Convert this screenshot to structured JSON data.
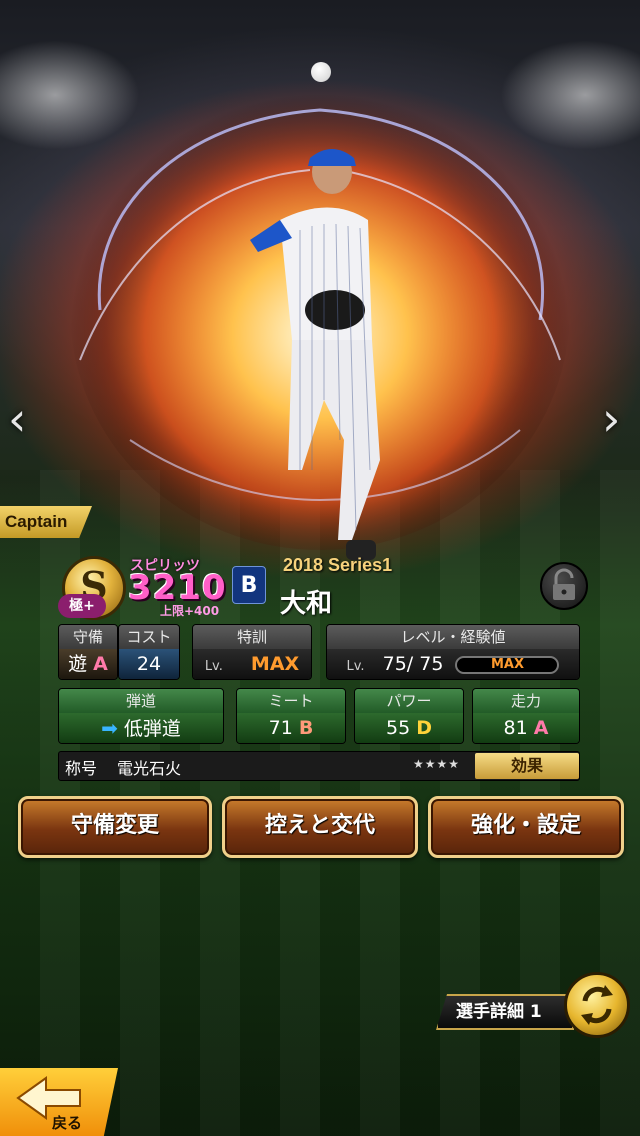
{
  "nav": {
    "prev_glyph": "‹",
    "next_glyph": "›"
  },
  "captain": {
    "label": "Captain"
  },
  "card": {
    "rarity": "S",
    "kiwami_label": "極+",
    "spirits_label": "スピリッツ",
    "spirits_value": "3210",
    "spirits_cap_label": "上限+400",
    "team_logo": "B",
    "series": "2018 Series1",
    "name": "大和"
  },
  "stats": {
    "position": {
      "header": "守備",
      "value": "遊",
      "grade": "A"
    },
    "cost": {
      "header": "コスト",
      "value": "24"
    },
    "training": {
      "header": "特訓",
      "lv_label": "Lv.",
      "value": "MAX"
    },
    "level": {
      "header": "レベル・経験値",
      "lv_label": "Lv.",
      "current": "75",
      "sep": "/",
      "max": "75",
      "exp_label": "MAX"
    },
    "trajectory": {
      "header": "弾道",
      "value": "低弾道"
    },
    "meet": {
      "header": "ミート",
      "value": "71",
      "grade": "B"
    },
    "power": {
      "header": "パワー",
      "value": "55",
      "grade": "D"
    },
    "speed": {
      "header": "走力",
      "value": "81",
      "grade": "A"
    }
  },
  "title_row": {
    "label": "称号",
    "value": "電光石火",
    "stars": "★★★★",
    "effect_button": "効果"
  },
  "actions": {
    "position_change": "守備変更",
    "substitute": "控えと交代",
    "enhance": "強化・設定"
  },
  "detail": {
    "label": "選手詳細 1"
  },
  "back": {
    "label": "戻る"
  },
  "colors": {
    "accent_gold": "#f0d08a",
    "button_brown": "#7a3510",
    "spirits_pink": "#ff5fc8"
  }
}
